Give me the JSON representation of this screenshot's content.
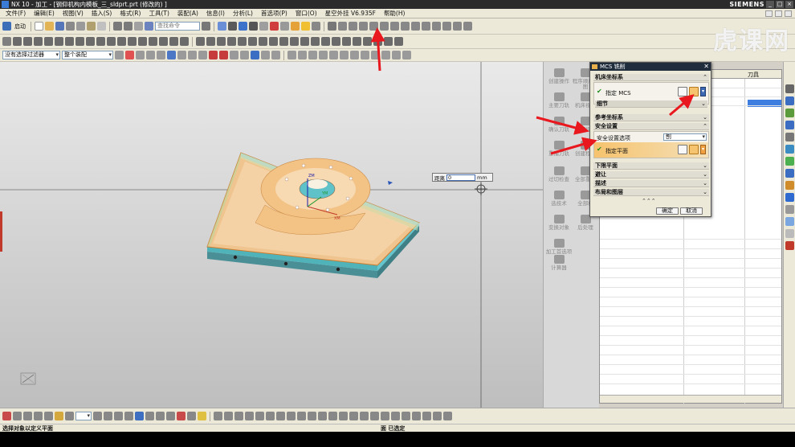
{
  "window": {
    "title": "NX 10 - 加工 - [钢仰机构内模板_三_sldprt.prt  (修改的) ]",
    "brand": "SIEMENS",
    "controls": [
      "_",
      "□",
      "×"
    ]
  },
  "menu": [
    "文件(F)",
    "编辑(E)",
    "视图(V)",
    "插入(S)",
    "格式(R)",
    "工具(T)",
    "装配(A)",
    "信息(I)",
    "分析(L)",
    "首选项(P)",
    "窗口(O)",
    "星空外挂 V6.935F",
    "帮助(H)"
  ],
  "toolbar": {
    "start_label": "启动",
    "search_placeholder": "查找命令",
    "filter_select": "没有选择过滤器",
    "assembly_select": "整个装配"
  },
  "watermark": "虎课网",
  "resource_panel": [
    "创建操作",
    "程序顺序视图",
    "主要刀轨",
    "机床视图",
    "确认刀轨",
    "几何视图",
    "重播刀轨",
    "创建程序",
    "过切检查",
    "全部重置",
    "选技术",
    "全部机",
    "后处理",
    "变换对象",
    "加工首选项",
    "计算器"
  ],
  "navigator": {
    "column_tool": "刀具"
  },
  "viewport": {
    "distance_label": "距离",
    "distance_value": "0",
    "distance_unit": "mm",
    "axis_labels": [
      "ZM",
      "XM",
      "YM"
    ]
  },
  "dialog": {
    "title": "MCS 铣削",
    "machine_coord_section": "机床坐标系",
    "specify_mcs": "指定 MCS",
    "details_section": "细节",
    "ref_coord_section": "参考坐标系",
    "safety_section": "安全设置",
    "safety_option_label": "安全设置选项",
    "safety_option_value": "刨",
    "specify_plane": "指定平面",
    "lower_limit_section": "下限平面",
    "avoid_section": "避让",
    "description_section": "描述",
    "layout_section": "布局和图层",
    "ok": "确定",
    "cancel": "取消"
  },
  "status": {
    "left": "选择对象以定义平面",
    "mid": "面 已选定"
  },
  "colors": {
    "dialog_title": "#1f2d3d",
    "highlight_row": "#f6c36e",
    "annotation_arrow": "#e8181e",
    "model_top": "#f2c893",
    "model_side": "#4fb3b9"
  }
}
